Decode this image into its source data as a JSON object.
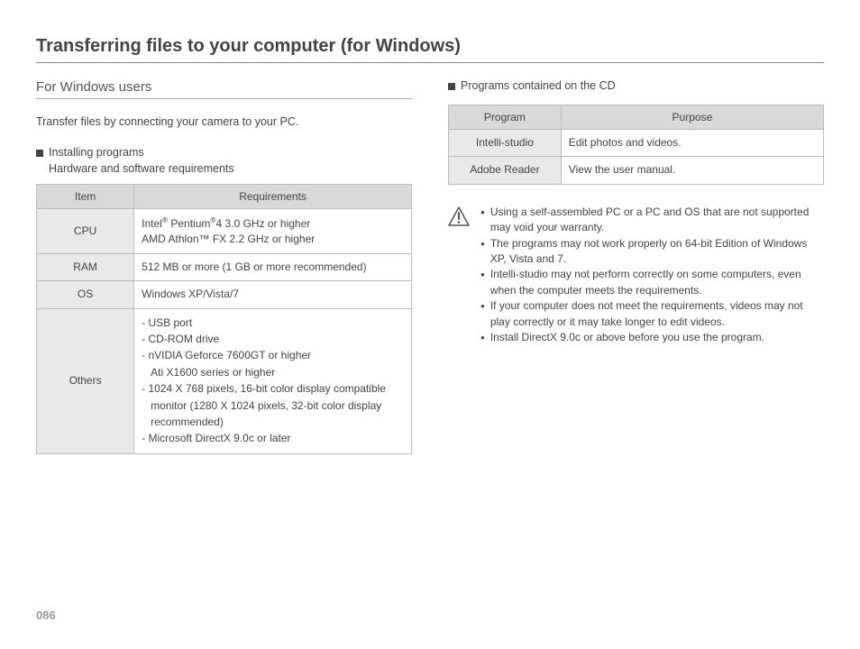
{
  "title": "Transferring files to your computer (for Windows)",
  "pageNumber": "086",
  "left": {
    "heading": "For Windows users",
    "intro": "Transfer files by connecting your camera to your PC.",
    "sub1": "Installing programs",
    "sub1cap": "Hardware and software requirements",
    "reqTable": {
      "h1": "Item",
      "h2": "Requirements",
      "rows": {
        "cpu": {
          "label": "CPU",
          "l1a": "Intel",
          "l1b": " Pentium",
          "l1c": "4 3.0 GHz or higher",
          "l2": "AMD Athlon™ FX 2.2 GHz or higher"
        },
        "ram": {
          "label": "RAM",
          "val": "512 MB or more (1 GB or more recommended)"
        },
        "os": {
          "label": "OS",
          "val": "Windows XP/Vista/7"
        },
        "others": {
          "label": "Others",
          "o1": "- USB port",
          "o2": "- CD-ROM drive",
          "o3": "- nVIDIA Geforce 7600GT or higher",
          "o3b": "Ati X1600 series or higher",
          "o4": "- 1024 X 768 pixels, 16-bit color display compatible",
          "o4b": "monitor (1280 X 1024 pixels, 32-bit color display",
          "o4c": "recommended)",
          "o5": "- Microsoft DirectX 9.0c or later"
        }
      }
    }
  },
  "right": {
    "sub2": "Programs contained on the CD",
    "progTable": {
      "h1": "Program",
      "h2": "Purpose",
      "r1": {
        "label": "Intelli-studio",
        "val": "Edit photos and videos."
      },
      "r2": {
        "label": "Adobe Reader",
        "val": "View the user manual."
      }
    },
    "warnings": {
      "w1": "Using a self-assembled PC or a PC and OS that are not supported may void your warranty.",
      "w2": "The programs may not work properly on 64-bit Edition of Windows XP, Vista and 7.",
      "w3": "Intelli-studio may not perform correctly on some computers, even when the computer meets the requirements.",
      "w4": "If your computer does not meet the requirements, videos may not play correctly or it may take longer to edit videos.",
      "w5": "Install DirectX 9.0c or above before you use the program."
    }
  }
}
